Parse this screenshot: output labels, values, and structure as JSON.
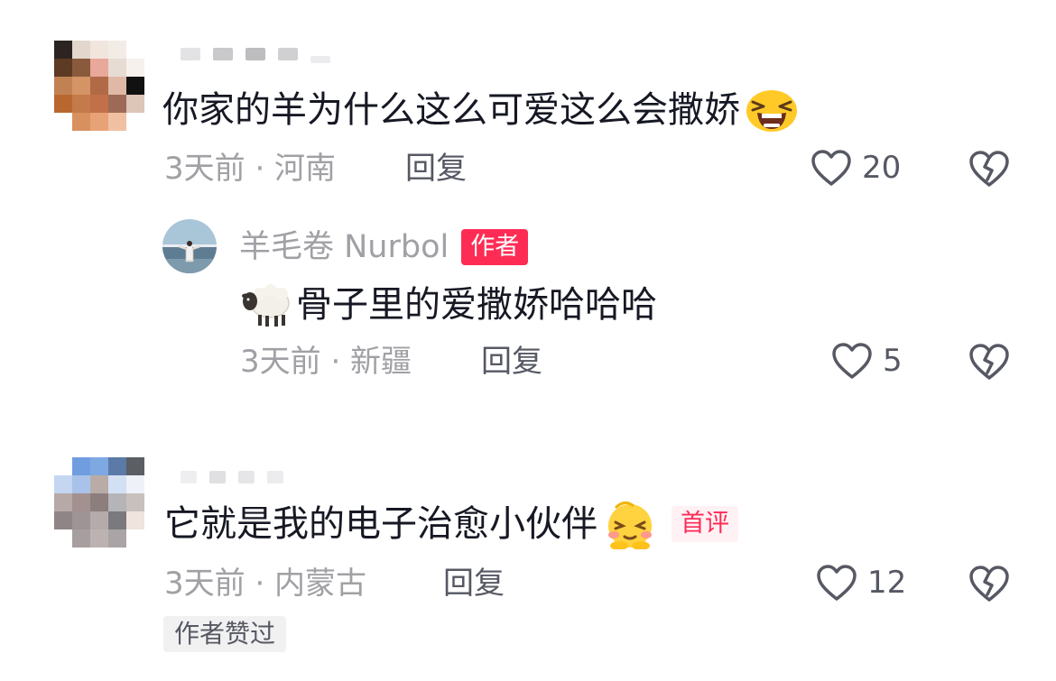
{
  "comments": [
    {
      "text": "你家的羊为什么这么可爱这么会撒娇",
      "emoji": "laughing-face-emoji",
      "time_location": "3天前 · 河南",
      "reply_label": "回复",
      "likes": "20",
      "replies": [
        {
          "author": "羊毛卷 Nurbol",
          "author_badge": "作者",
          "emoji": "sheep-emoji",
          "text": "骨子里的爱撒娇哈哈哈",
          "time_location": "3天前 · 新疆",
          "reply_label": "回复",
          "likes": "5"
        }
      ]
    },
    {
      "text": "它就是我的电子治愈小伙伴",
      "emoji": "shy-face-emoji",
      "badge": "首评",
      "time_location": "3天前 · 内蒙古",
      "reply_label": "回复",
      "likes": "12",
      "author_liked": "作者赞过"
    }
  ],
  "colors": {
    "accent": "#fe2c55",
    "meta_text": "#a0a0a5",
    "primary_text": "#161823"
  }
}
